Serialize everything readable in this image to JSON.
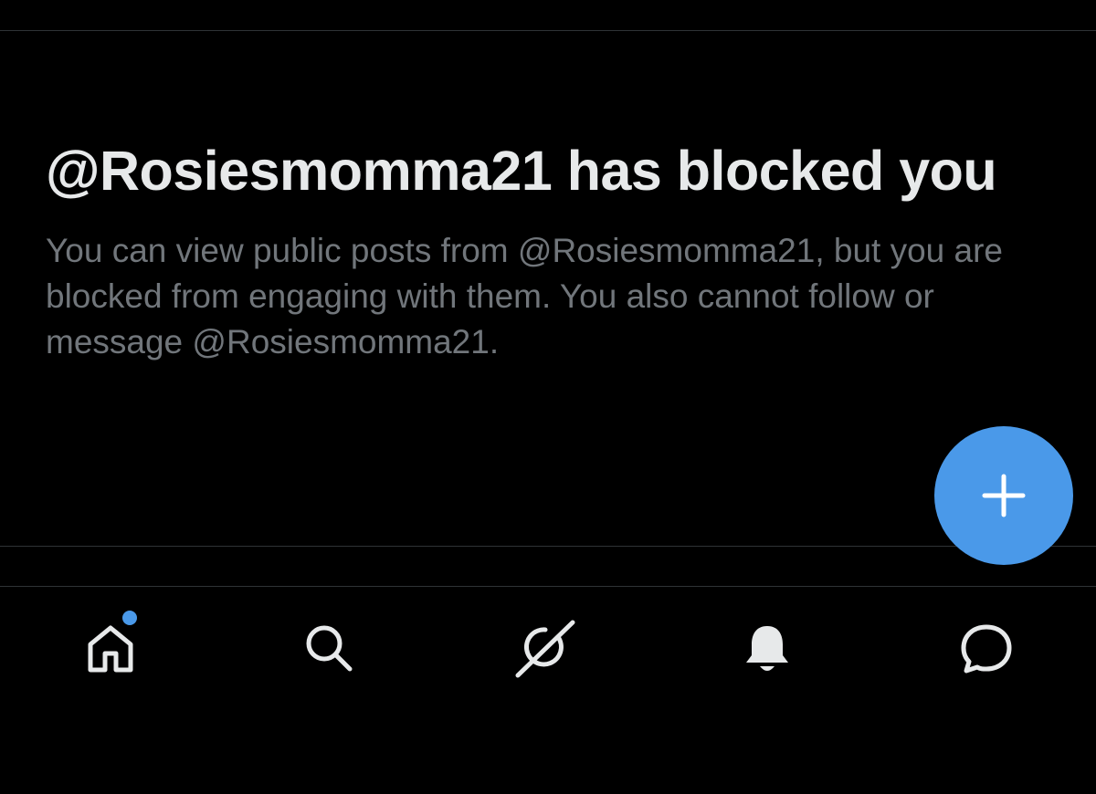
{
  "blocked": {
    "headline": "@Rosiesmomma21 has blocked you",
    "description": "You can view public posts from @Rosiesmomma21, but you are blocked from engaging with them. You also cannot follow or message @Rosiesmomma21."
  },
  "fab": {
    "icon": "plus-icon",
    "color": "#4a99e9"
  },
  "bottom_nav": {
    "items": [
      {
        "name": "home",
        "icon": "home-icon",
        "has_unread_dot": true
      },
      {
        "name": "search",
        "icon": "search-icon"
      },
      {
        "name": "grok",
        "icon": "grok-icon"
      },
      {
        "name": "notifications",
        "icon": "bell-icon"
      },
      {
        "name": "messages",
        "icon": "message-bubble-icon"
      }
    ]
  },
  "colors": {
    "background": "#000000",
    "primary_text": "#e7e9ea",
    "secondary_text": "#71767b",
    "accent": "#4a99e9",
    "divider": "#2f3336"
  }
}
